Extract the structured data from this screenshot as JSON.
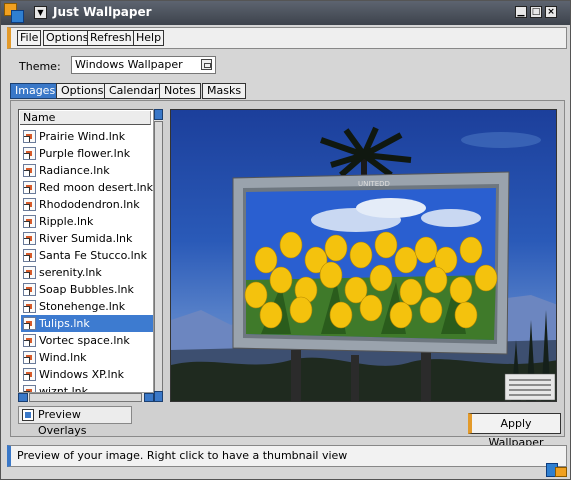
{
  "window": {
    "title": "Just Wallpaper"
  },
  "menu": {
    "file": "File",
    "options": "Options",
    "refresh": "Refresh",
    "help": "Help"
  },
  "theme": {
    "label": "Theme:",
    "value": "Windows Wallpaper"
  },
  "tabs": [
    {
      "label": "Images",
      "active": true
    },
    {
      "label": "Options",
      "active": false
    },
    {
      "label": "Calendar",
      "active": false
    },
    {
      "label": "Notes",
      "active": false
    },
    {
      "label": "Masks",
      "active": false
    }
  ],
  "file_list": {
    "header": "Name",
    "items": [
      {
        "name": "Prairie Wind.lnk",
        "selected": false
      },
      {
        "name": "Purple flower.lnk",
        "selected": false
      },
      {
        "name": "Radiance.lnk",
        "selected": false
      },
      {
        "name": "Red moon desert.lnk",
        "selected": false
      },
      {
        "name": "Rhododendron.lnk",
        "selected": false
      },
      {
        "name": "Ripple.lnk",
        "selected": false
      },
      {
        "name": "River Sumida.lnk",
        "selected": false
      },
      {
        "name": "Santa Fe Stucco.lnk",
        "selected": false
      },
      {
        "name": "serenity.lnk",
        "selected": false
      },
      {
        "name": "Soap Bubbles.lnk",
        "selected": false
      },
      {
        "name": "Stonehenge.lnk",
        "selected": false
      },
      {
        "name": "Tulips.lnk",
        "selected": true
      },
      {
        "name": "Vortec space.lnk",
        "selected": false
      },
      {
        "name": "Wind.lnk",
        "selected": false
      },
      {
        "name": "Windows XP.lnk",
        "selected": false
      },
      {
        "name": "wiznt.lnk",
        "selected": false
      }
    ]
  },
  "preview": {
    "billboard_brand": "UNITEDD"
  },
  "controls": {
    "preview_overlays": "Preview Overlays",
    "apply_wallpaper": "Apply Wallpaper"
  },
  "status": {
    "text": "Preview of your image. Right click to have a thumbnail view"
  },
  "colors": {
    "accent_blue": "#3a78c8",
    "accent_orange": "#e39a2a",
    "tulip_yellow": "#f4c20d"
  }
}
